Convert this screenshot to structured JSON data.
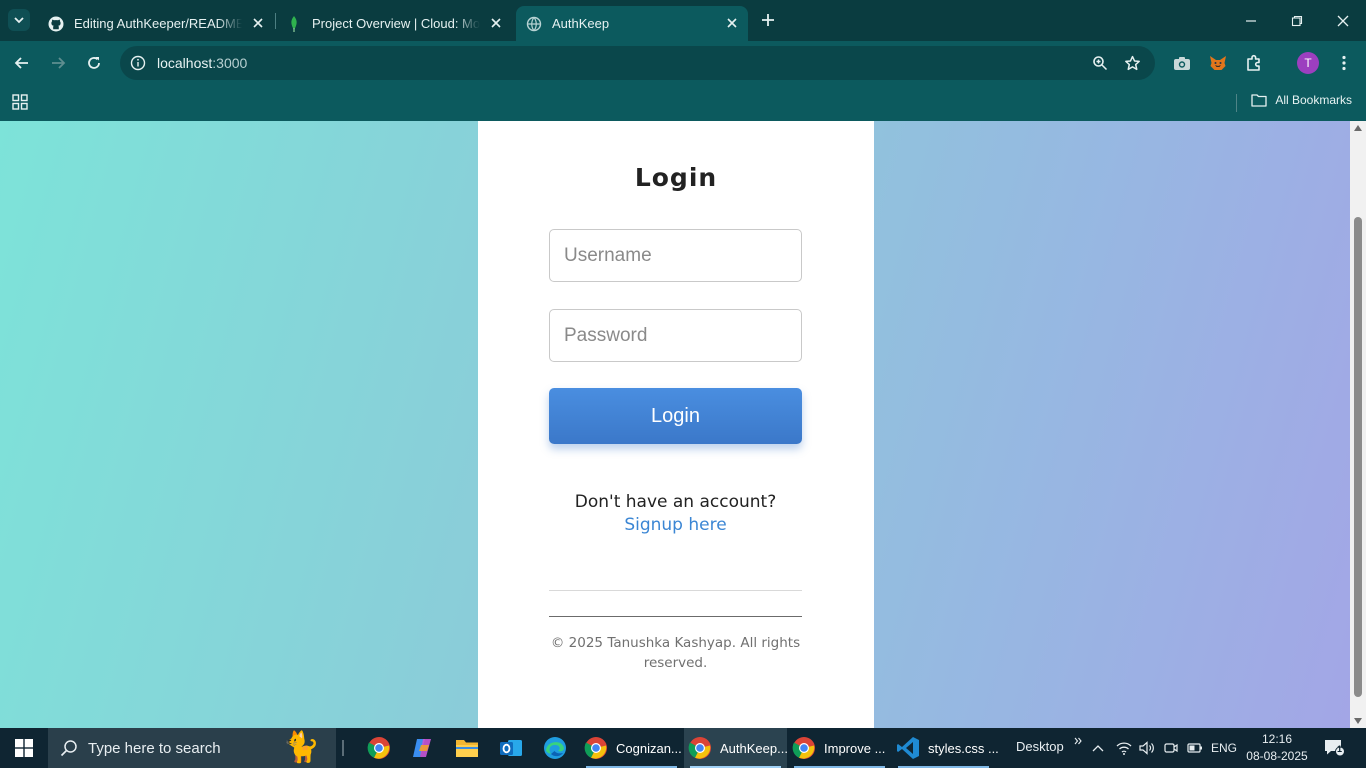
{
  "browser": {
    "tabs": [
      {
        "title": "Editing AuthKeeper/README.md",
        "icon": "github-icon",
        "active": false
      },
      {
        "title": "Project Overview | Cloud: MongoDB Cloud",
        "icon": "mongodb-leaf-icon",
        "active": false
      },
      {
        "title": "AuthKeep",
        "icon": "globe-icon",
        "active": true
      }
    ],
    "url_host": "localhost",
    "url_port": ":3000",
    "profile_initial": "T",
    "bookmarks_label": "All Bookmarks",
    "accent_color": "#0c5a5e"
  },
  "page": {
    "heading": "Login",
    "username_placeholder": "Username",
    "password_placeholder": "Password",
    "login_button": "Login",
    "signup_prompt": "Don't have an account? ",
    "signup_link": "Signup here",
    "footer": "© 2025 Tanushka Kashyap. All rights reserved.",
    "button_color": "#4a8ee0",
    "link_color": "#3b86d4"
  },
  "taskbar": {
    "search_placeholder": "Type here to search",
    "apps": [
      {
        "label": "Cognizan...",
        "icon": "chrome-icon"
      },
      {
        "label": "AuthKeep...",
        "icon": "chrome-icon",
        "active": true
      },
      {
        "label": "Improve ...",
        "icon": "chrome-icon"
      },
      {
        "label": "styles.css ...",
        "icon": "vscode-icon"
      }
    ],
    "desktop_label": "Desktop",
    "language": "ENG",
    "time": "12:16",
    "date": "08-08-2025",
    "notification_count": "1"
  }
}
